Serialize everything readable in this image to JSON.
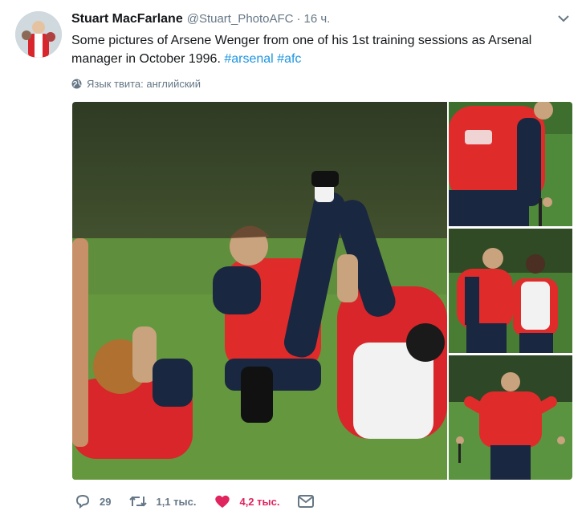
{
  "tweet": {
    "author_name": "Stuart MacFarlane",
    "author_handle": "@Stuart_PhotoAFC",
    "separator": "·",
    "time": "16 ч.",
    "text_main": "Some pictures of Arsene Wenger from one of his 1st training sessions as Arsenal manager in October 1996. ",
    "hashtags": [
      "#arsenal",
      "#afc"
    ],
    "language_note": "Язык твита: английский",
    "actions": {
      "replies": "29",
      "retweets": "1,1 тыс.",
      "likes": "4,2 тыс."
    },
    "colors": {
      "hashtag": "#1b95e0",
      "like": "#e0245e",
      "muted": "#657786"
    },
    "icons": [
      "chevron-down-icon",
      "globe-icon",
      "reply-icon",
      "retweet-icon",
      "heart-icon",
      "message-icon"
    ]
  }
}
